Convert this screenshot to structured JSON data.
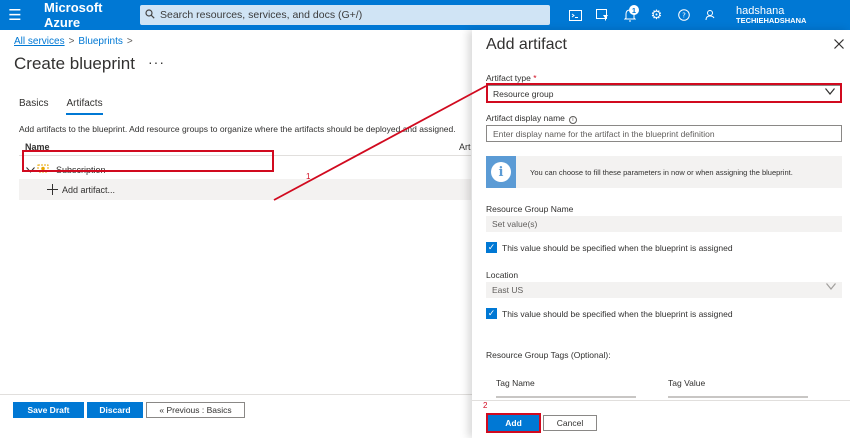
{
  "topbar": {
    "brand": "Microsoft Azure",
    "search_placeholder": "Search resources, services, and docs (G+/)",
    "notification_count": "1",
    "user": "hadshana",
    "tenant": "TECHIEHADSHANA",
    "icons": [
      "hamburger-icon",
      "search-icon",
      "cloud-shell-icon",
      "directory-filter-icon",
      "bell-icon",
      "gear-icon",
      "help-icon",
      "feedback-icon"
    ]
  },
  "breadcrumb": {
    "items": [
      "All services",
      "Blueprints"
    ],
    "separator": ">"
  },
  "page": {
    "title": "Create blueprint",
    "more": "···"
  },
  "tabs": [
    {
      "label": "Basics",
      "active": false
    },
    {
      "label": "Artifacts",
      "active": true
    }
  ],
  "artifacts": {
    "description": "Add artifacts to the blueprint. Add resource groups to organize where the artifacts should be deployed and assigned.",
    "col_name": "Name",
    "col_type": "Art",
    "subscription_label": "Subscription",
    "add_artifact_label": "Add artifact..."
  },
  "left_footer": {
    "save_draft": "Save Draft",
    "discard": "Discard",
    "previous": "« Previous : Basics"
  },
  "panel": {
    "title": "Add artifact",
    "artifact_type_label": "Artifact type",
    "required_mark": "*",
    "artifact_type_value": "Resource group",
    "display_name_label": "Artifact display name",
    "display_name_placeholder": "Enter display name for the artifact in the blueprint definition",
    "info_text": "You can choose to fill these parameters in now or when assigning the blueprint.",
    "rg_name_label": "Resource Group Name",
    "rg_name_value": "Set value(s)",
    "rg_name_checkbox": "This value should be specified when the blueprint is assigned",
    "location_label": "Location",
    "location_value": "East US",
    "location_checkbox": "This value should be specified when the blueprint is assigned",
    "tags_label": "Resource Group Tags (Optional):",
    "tag_name_header": "Tag Name",
    "tag_value_header": "Tag Value",
    "add_button": "Add",
    "cancel_button": "Cancel"
  },
  "annotations": {
    "step1": "1",
    "step2": "2",
    "highlight_color": "#d10a1f"
  },
  "colors": {
    "accent": "#0078d4",
    "topbar": "#0078d4",
    "annotation": "#d10a1f"
  }
}
